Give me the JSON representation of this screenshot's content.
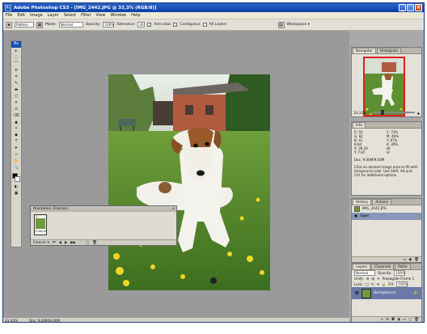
{
  "window": {
    "title": "Adobe Photoshop CS3 - [IMG_2442.JPG @ 33,3% (RGB/8)]",
    "app_icon": "Ps",
    "controls": [
      "_",
      "□",
      "×"
    ]
  },
  "menu": [
    "File",
    "Edit",
    "Image",
    "Layer",
    "Select",
    "Filter",
    "View",
    "Window",
    "Help"
  ],
  "options": {
    "fill_value": "Pattern",
    "mode_label": "Mode:",
    "mode_value": "Normal",
    "opacity_label": "Opacity:",
    "opacity_value": "100%",
    "tolerance_label": "Tolerance:",
    "tolerance_value": "32",
    "anti_alias": "Anti-alias",
    "contiguous": "Contiguous",
    "all_layers": "All Layers",
    "workspace": "Workspace ▾"
  },
  "toolbox": {
    "header": "Ps",
    "tools": [
      "▸",
      "⬚",
      "⌒",
      "✢",
      "⌗",
      "✎",
      "▬",
      "⬡",
      "✶",
      "⊙",
      "⌫",
      "▲",
      "☼",
      "◆",
      "T",
      "➤",
      "▭",
      "✋",
      "🔍"
    ]
  },
  "navigator": {
    "tabs": [
      "Navigator",
      "Histogram"
    ],
    "zoom": "33,33%"
  },
  "info": {
    "tabs": [
      "Info"
    ],
    "rows": [
      [
        "R:",
        "50"
      ],
      [
        "C:",
        "72%"
      ],
      [
        "G:",
        "82"
      ],
      [
        "M:",
        "40%"
      ],
      [
        "B:",
        "41"
      ],
      [
        "Y:",
        "97%"
      ],
      [
        "8-bit",
        ""
      ],
      [
        "K:",
        "39%"
      ],
      [
        "X:",
        "28.20"
      ],
      [
        "W:",
        ""
      ],
      [
        "Y:",
        "7.87"
      ],
      [
        "H:",
        ""
      ]
    ],
    "doc": "Doc: 9,00M/9,00M",
    "note": "Click on desired image area to fill with foreground color. Use Shift, Alt and Ctrl for additional options"
  },
  "history": {
    "tabs": [
      "History",
      "Actions"
    ],
    "snapshot": "IMG_2442.JPG",
    "items": [
      "Open"
    ]
  },
  "layers": {
    "tabs": [
      "Layers",
      "Channels",
      "Paths"
    ],
    "blend": "Normal",
    "opacity_label": "Opacity:",
    "opacity_value": "100%",
    "lock_label": "Lock:",
    "fill_label": "Fill:",
    "fill_value": "100%",
    "unify": "Unify:",
    "propagate": "Propagate Frame 1",
    "layer_name": "Background"
  },
  "animation": {
    "title": "Animation (Frames)",
    "frame_num": "1",
    "frame_duration": "0 sec.▾",
    "loop": "Forever ▾"
  },
  "status": {
    "zoom": "33,33%",
    "doc": "Doc: 9,00M/9,00M"
  },
  "colors": {
    "title_blue": "#0b3fa8",
    "grass_green": "#5e8f32",
    "layer_selected": "#6a7aa8",
    "nav_frame_red": "#e02020"
  }
}
